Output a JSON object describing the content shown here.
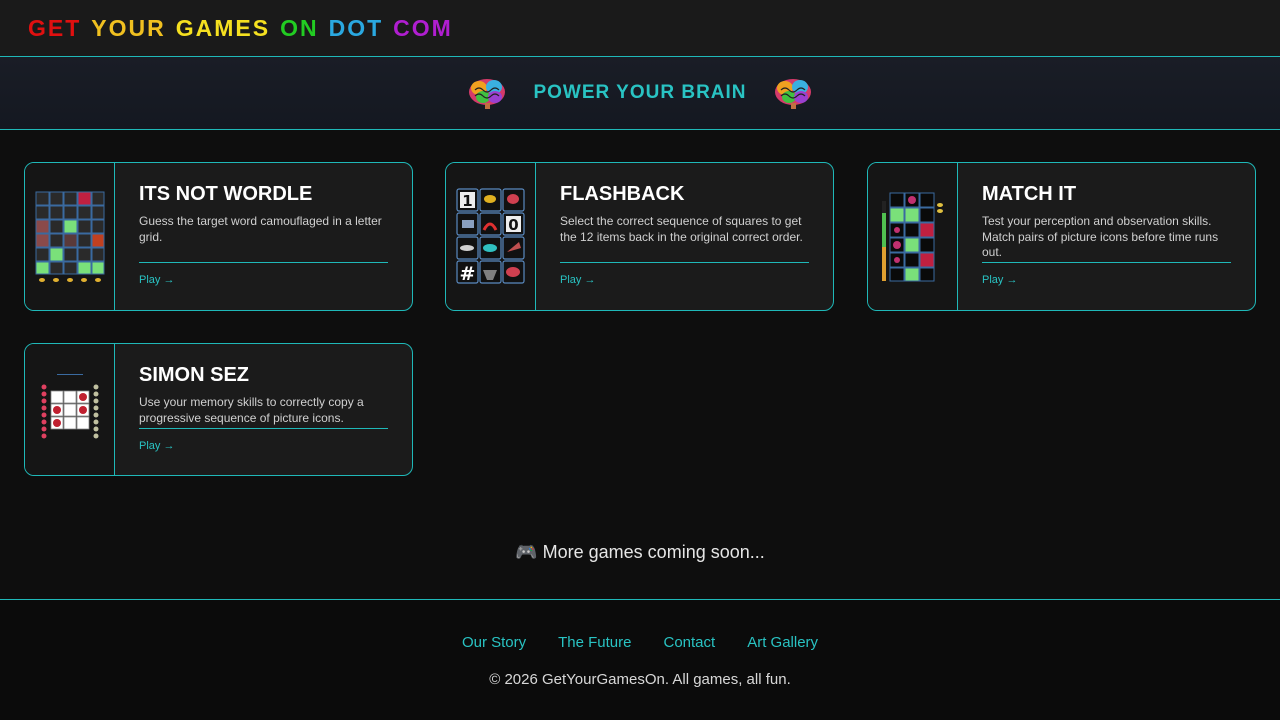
{
  "header": {
    "logo_words": [
      {
        "text": "GET",
        "color": "#e01010"
      },
      {
        "text": "YOUR",
        "color": "#f0c020"
      },
      {
        "text": "GAMES",
        "color": "#f5e020"
      },
      {
        "text": "ON",
        "color": "#22cc22"
      },
      {
        "text": "DOT",
        "color": "#2aa8e0"
      },
      {
        "text": "COM",
        "color": "#b01ed0"
      }
    ]
  },
  "hero": {
    "title": "POWER YOUR BRAIN",
    "icon_left": "brain-icon",
    "icon_right": "brain-icon"
  },
  "games": [
    {
      "title": "ITS NOT WORDLE",
      "description": "Guess the target word camouflaged in a letter grid.",
      "play_label": "Play →",
      "thumb": "wordle-grid-thumbnail"
    },
    {
      "title": "FLASHBACK",
      "description": "Select the correct sequence of squares to get the 12 items back in the original correct order.",
      "play_label": "Play →",
      "thumb": "flashback-grid-thumbnail"
    },
    {
      "title": "MATCH IT",
      "description": "Test your perception and observation skills. Match pairs of picture icons before time runs out.",
      "play_label": "Play →",
      "thumb": "match-grid-thumbnail"
    },
    {
      "title": "SIMON SEZ",
      "description": "Use your memory skills to correctly copy a progressive sequence of picture icons.",
      "play_label": "Play →",
      "thumb": "simon-grid-thumbnail"
    }
  ],
  "coming_soon": "🎮 More games coming soon...",
  "footer": {
    "links": [
      "Our Story",
      "The Future",
      "Contact",
      "Art Gallery"
    ],
    "copyright": "© 2026 GetYourGamesOn. All games, all fun."
  },
  "colors": {
    "accent": "#1fb8b8",
    "accent_text": "#29c3c3",
    "background": "#0e0e0e",
    "card": "#1b1b1b"
  }
}
